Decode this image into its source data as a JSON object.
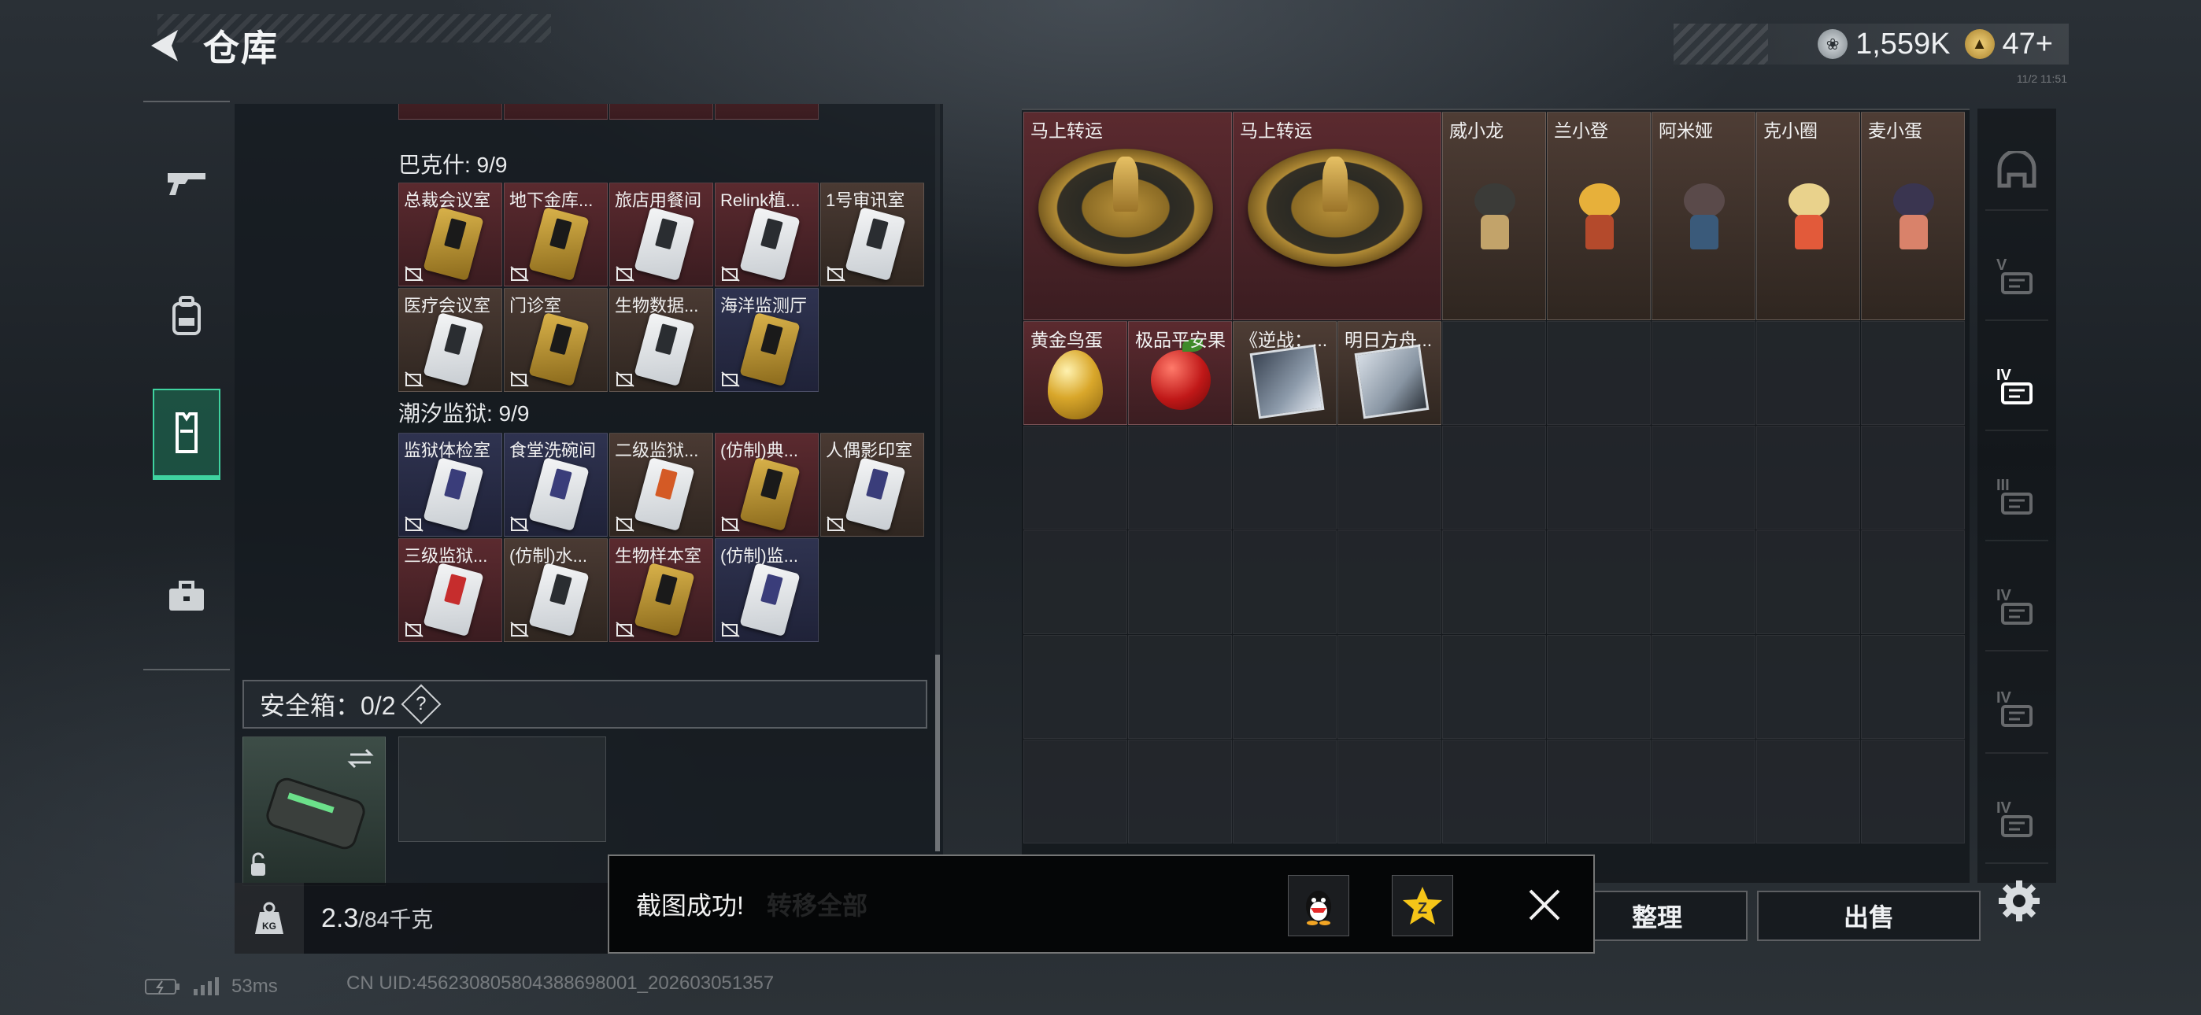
{
  "header": {
    "title": "仓库"
  },
  "currency": {
    "silver": "1,559K",
    "gold": "47+"
  },
  "corner_tiny_text": "11/2 11:51",
  "left_nav": [
    "gun-icon",
    "backpack-icon",
    "vest-icon",
    "briefcase-icon"
  ],
  "left_panel": {
    "top_partial_row_count": 4,
    "sections": [
      {
        "title": "巴克什: 9/9",
        "cards": [
          {
            "name": "总裁会议室",
            "tone": "red",
            "card": "gold"
          },
          {
            "name": "地下金库...",
            "tone": "red",
            "card": "gold"
          },
          {
            "name": "旅店用餐间",
            "tone": "red",
            "card": "white"
          },
          {
            "name": "Relink植...",
            "tone": "red",
            "card": "white"
          },
          {
            "name": "1号审讯室",
            "tone": "brown",
            "card": "white"
          },
          {
            "name": "医疗会议室",
            "tone": "brown",
            "card": "white"
          },
          {
            "name": "门诊室",
            "tone": "brown",
            "card": "gold"
          },
          {
            "name": "生物数据...",
            "tone": "brown",
            "card": "white"
          },
          {
            "name": "海洋监测厅",
            "tone": "navy",
            "card": "gold"
          }
        ]
      },
      {
        "title": "潮汐监狱: 9/9",
        "cards": [
          {
            "name": "监狱体检室",
            "tone": "navy",
            "card": "blue"
          },
          {
            "name": "食堂洗碗间",
            "tone": "navy",
            "card": "blue"
          },
          {
            "name": "二级监狱...",
            "tone": "brown",
            "card": "orange"
          },
          {
            "name": "(仿制)典...",
            "tone": "red",
            "card": "gold"
          },
          {
            "name": "人偶影印室",
            "tone": "brown",
            "card": "blue"
          },
          {
            "name": "三级监狱...",
            "tone": "red",
            "card": "redstripe"
          },
          {
            "name": "(仿制)水...",
            "tone": "brown",
            "card": "white"
          },
          {
            "name": "生物样本室",
            "tone": "red",
            "card": "gold"
          },
          {
            "name": "(仿制)监...",
            "tone": "navy",
            "card": "blue"
          }
        ]
      }
    ],
    "safe_box": {
      "label": "安全箱：0/2",
      "help": "?"
    },
    "weight": {
      "current": "2.3",
      "max": "/84千克"
    }
  },
  "right_panel": {
    "items": [
      {
        "name": "马上转运",
        "kind": "wheel",
        "tone": "red"
      },
      {
        "name": "马上转运",
        "kind": "wheel",
        "tone": "red"
      },
      {
        "name": "威小龙",
        "kind": "figure",
        "tone": "brown",
        "head": "#3b3b38",
        "body": "#c2a36a"
      },
      {
        "name": "兰小登",
        "kind": "figure",
        "tone": "brown",
        "head": "#e7b03a",
        "body": "#b44a2c"
      },
      {
        "name": "阿米娅",
        "kind": "figure",
        "tone": "brown",
        "head": "#5a4a4a",
        "body": "#3a5a7a"
      },
      {
        "name": "克小圈",
        "kind": "figure",
        "tone": "brown",
        "head": "#e9d28c",
        "body": "#e25a3a"
      },
      {
        "name": "麦小蛋",
        "kind": "figure",
        "tone": "brown",
        "head": "#3a3550",
        "body": "#d9826a"
      },
      {
        "name": "黄金鸟蛋",
        "kind": "egg",
        "tone": "red"
      },
      {
        "name": "极品平安果",
        "kind": "apple",
        "tone": "red"
      },
      {
        "name": "《逆战：...",
        "kind": "cd",
        "tone": "brown"
      },
      {
        "name": "明日方舟...",
        "kind": "cd-light",
        "tone": "brown"
      }
    ]
  },
  "right_nav": [
    {
      "label": "",
      "icon": "helmet-icon"
    },
    {
      "label": "V",
      "icon": "vest-v-icon"
    },
    {
      "label": "IV",
      "icon": "vest-iv-icon",
      "active": true
    },
    {
      "label": "III",
      "icon": "vest-iii-icon"
    },
    {
      "label": "IV",
      "icon": "vest-iv-plus-icon"
    },
    {
      "label": "IV",
      "icon": "vest-iv-plus-icon-2"
    },
    {
      "label": "IV",
      "icon": "vest-iv-flat-icon"
    }
  ],
  "buttons": {
    "organize": "整理",
    "sell": "出售"
  },
  "toast": {
    "text": "截图成功!",
    "ghost_text": "转移全部"
  },
  "status": {
    "ping": "53ms",
    "uid": "CN UID:456230805804388698001_202603051357"
  }
}
